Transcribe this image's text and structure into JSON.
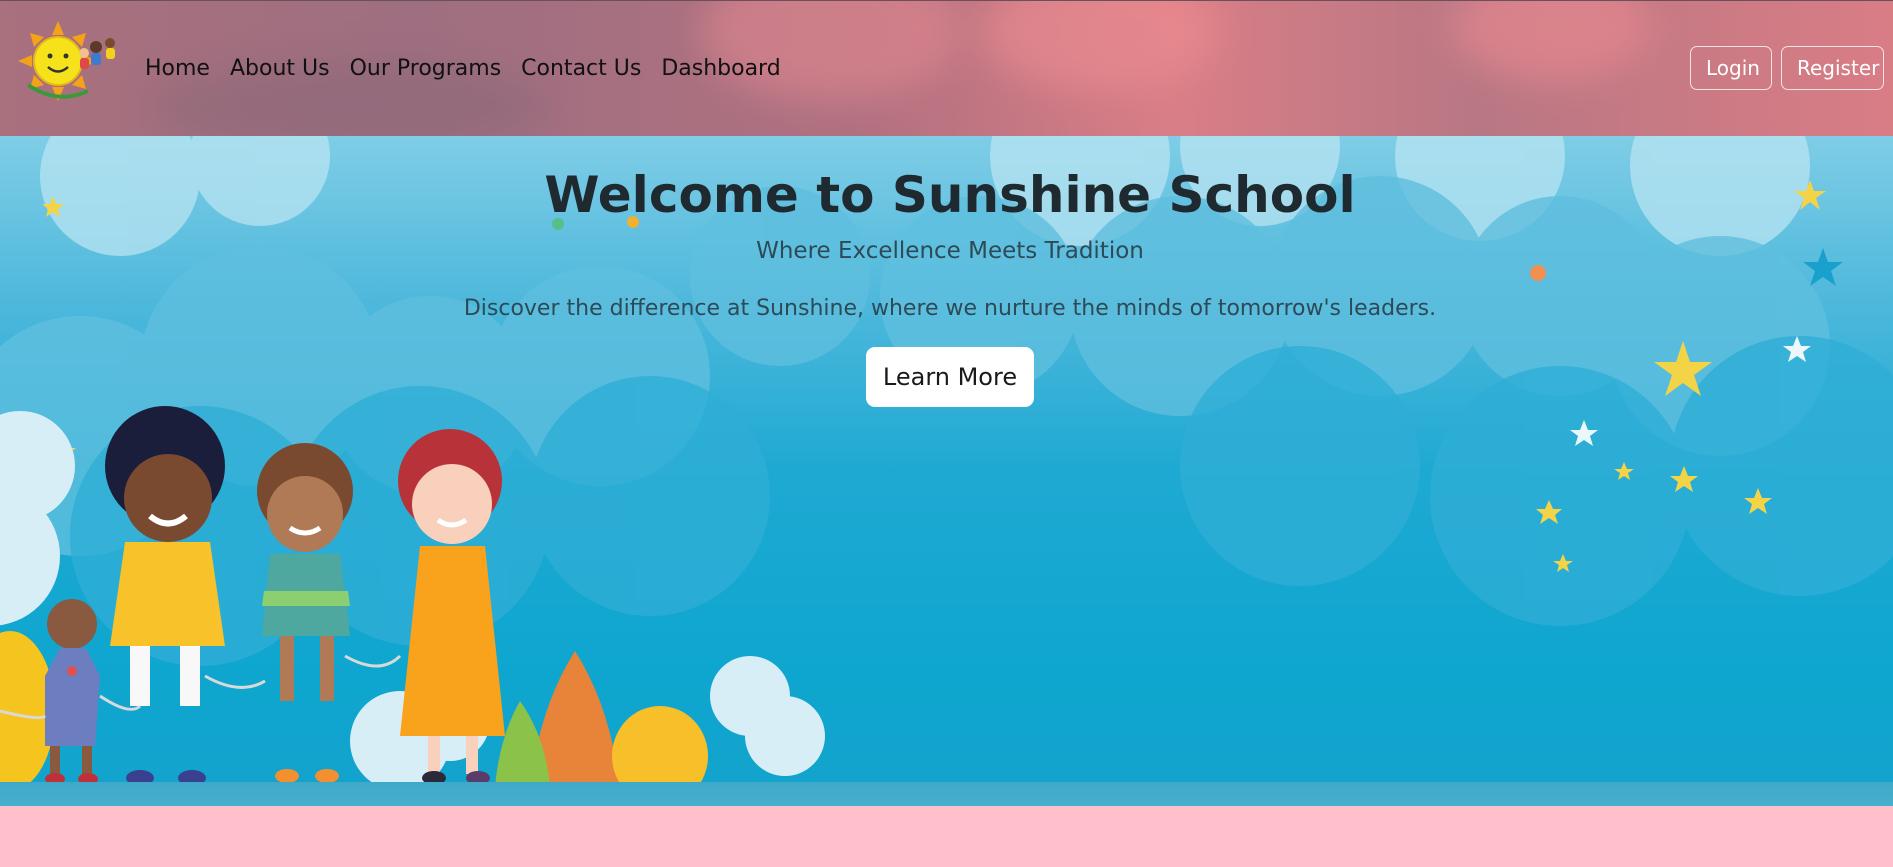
{
  "nav": {
    "links": [
      "Home",
      "About Us",
      "Our Programs",
      "Contact Us",
      "Dashboard"
    ],
    "login_label": "Login",
    "register_label": "Register"
  },
  "hero": {
    "title": "Welcome to Sunshine School",
    "subtitle": "Where Excellence Meets Tradition",
    "description": "Discover the difference at Sunshine, where we nurture the minds of tomorrow's leaders.",
    "cta_label": "Learn More"
  },
  "colors": {
    "navbar": "#b07080",
    "hero_sky": "#1ea9d2",
    "footer_band": "#ffc0cb",
    "button_bg": "#ffffff"
  },
  "icons": [
    "sunshine-logo",
    "star-icon"
  ]
}
